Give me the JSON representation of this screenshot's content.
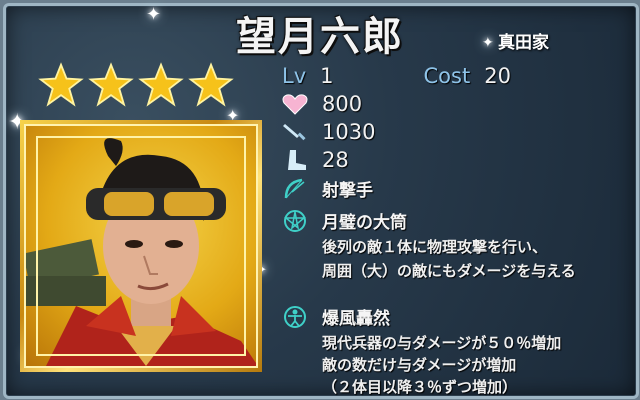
{
  "card": {
    "name": "望月六郎",
    "clan": "真田家",
    "stars": 4,
    "level_label": "Lv",
    "level": "1",
    "cost_label": "Cost",
    "cost": "20",
    "hp": "800",
    "attack": "1030",
    "speed": "28",
    "class": "射撃手"
  },
  "skill": {
    "name": "月璧の大筒",
    "lines": [
      "後列の敵１体に物理攻撃を行い、",
      "周囲（大）の敵にもダメージを与える"
    ]
  },
  "ability": {
    "name": "爆風轟然",
    "lines": [
      "現代兵器の与ダメージが５０％増加",
      "敵の数だけ与ダメージが増加",
      "（２体目以降３％ずつ増加）"
    ]
  },
  "colors": {
    "star": "#f6c21a",
    "label": "#8ec3e8",
    "frame_gold": "#e9b52b"
  },
  "icons": [
    "star-icon",
    "heart-icon",
    "sword-icon",
    "boot-icon",
    "bow-icon",
    "pentagram-icon",
    "person-rune-icon"
  ]
}
